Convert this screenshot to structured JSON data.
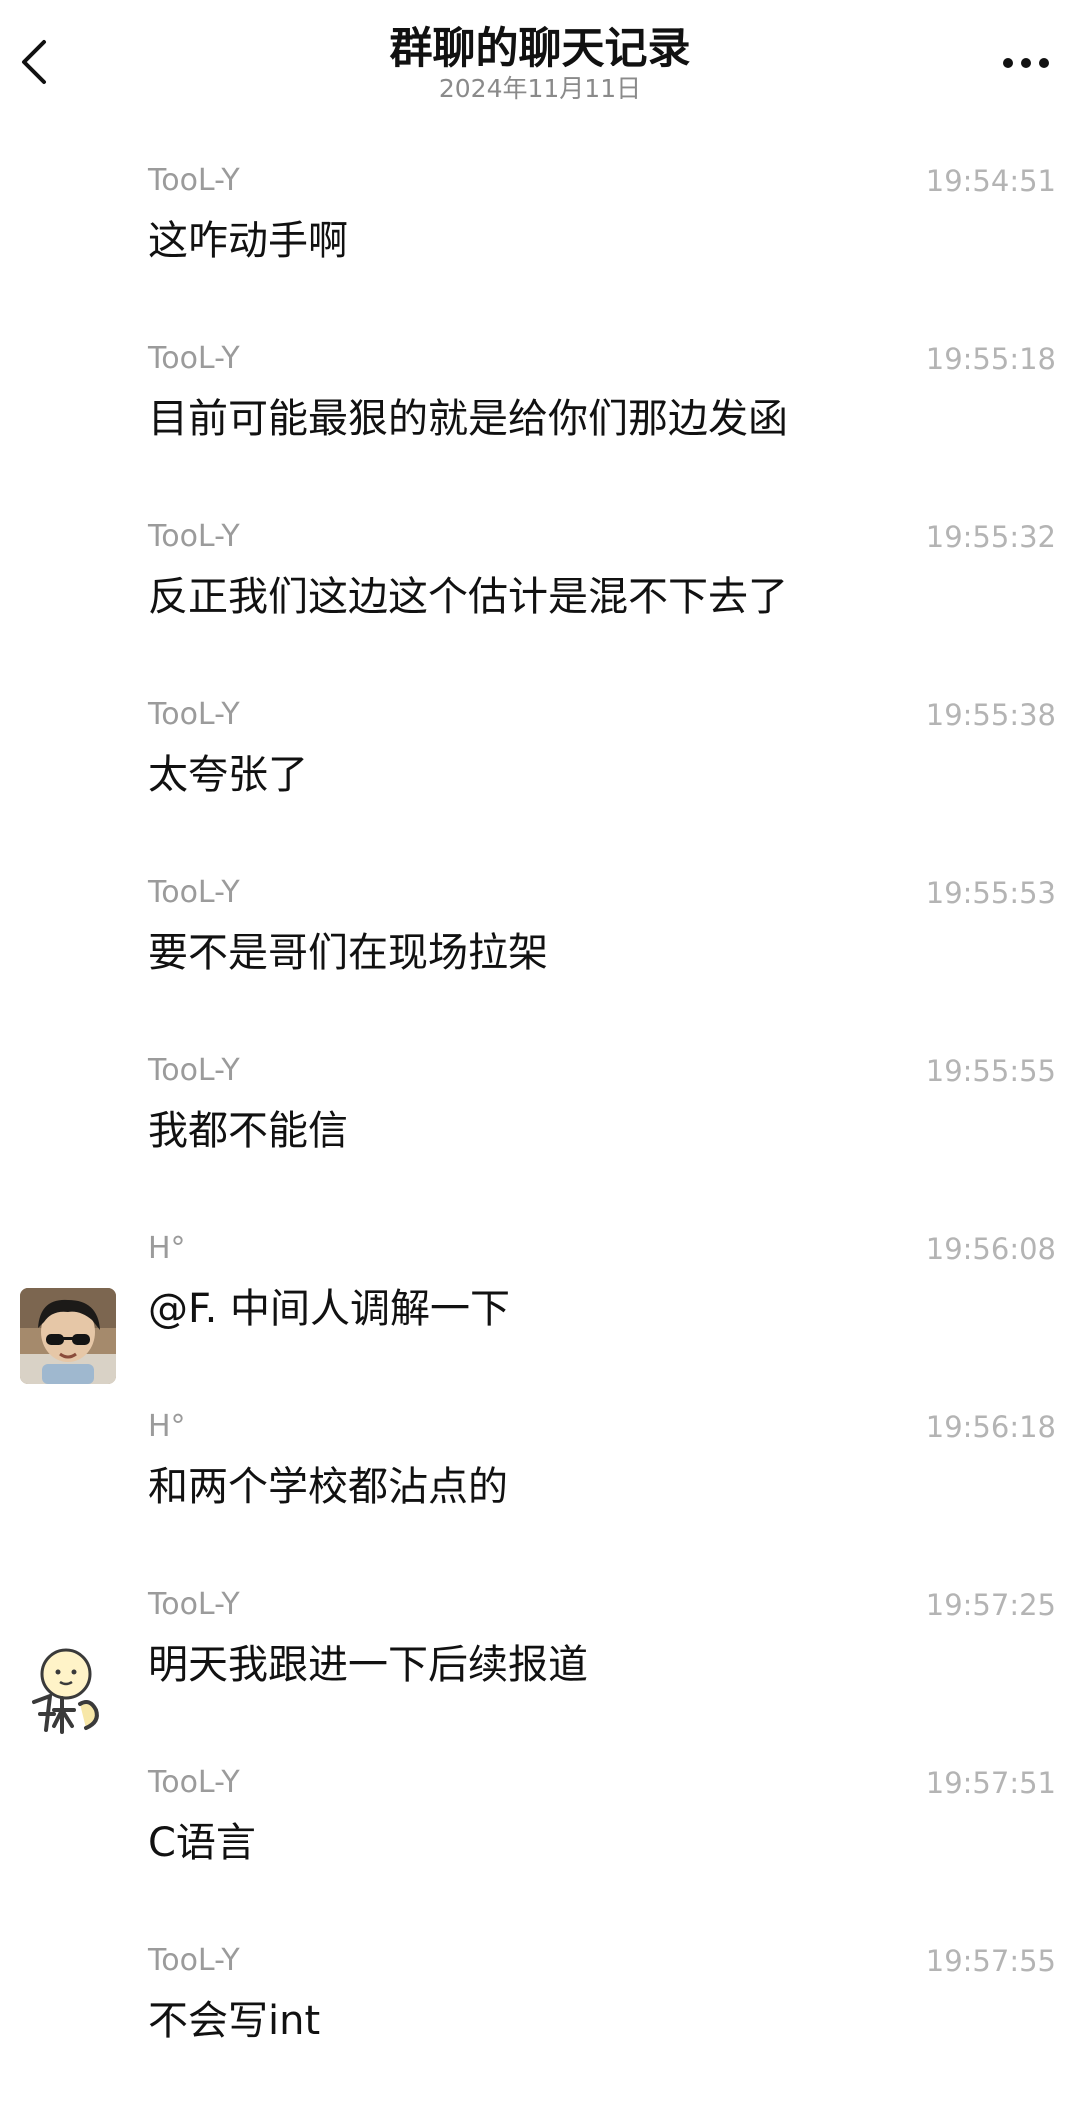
{
  "header": {
    "title": "群聊的聊天记录",
    "date": "2024年11月11日"
  },
  "icons": {
    "back": "chevron-left-icon",
    "more": "more-dots-icon"
  },
  "messages": [
    {
      "sender": "TooL-Y",
      "time": "19:54:51",
      "text": "这咋动手啊"
    },
    {
      "sender": "TooL-Y",
      "time": "19:55:18",
      "text": "目前可能最狠的就是给你们那边发函"
    },
    {
      "sender": "TooL-Y",
      "time": "19:55:32",
      "text": "反正我们这边这个估计是混不下去了"
    },
    {
      "sender": "TooL-Y",
      "time": "19:55:38",
      "text": "太夸张了"
    },
    {
      "sender": "TooL-Y",
      "time": "19:55:53",
      "text": "要不是哥们在现场拉架"
    },
    {
      "sender": "TooL-Y",
      "time": "19:55:55",
      "text": "我都不能信"
    },
    {
      "sender": "H°",
      "time": "19:56:08",
      "text": "@F. 中间人调解一下",
      "avatar": "photo-avatar"
    },
    {
      "sender": "H°",
      "time": "19:56:18",
      "text": "和两个学校都沾点的"
    },
    {
      "sender": "TooL-Y",
      "time": "19:57:25",
      "text": "明天我跟进一下后续报道",
      "avatar": "cartoon-avatar"
    },
    {
      "sender": "TooL-Y",
      "time": "19:57:51",
      "text": "C语言"
    },
    {
      "sender": "TooL-Y",
      "time": "19:57:55",
      "text": "不会写int"
    }
  ]
}
